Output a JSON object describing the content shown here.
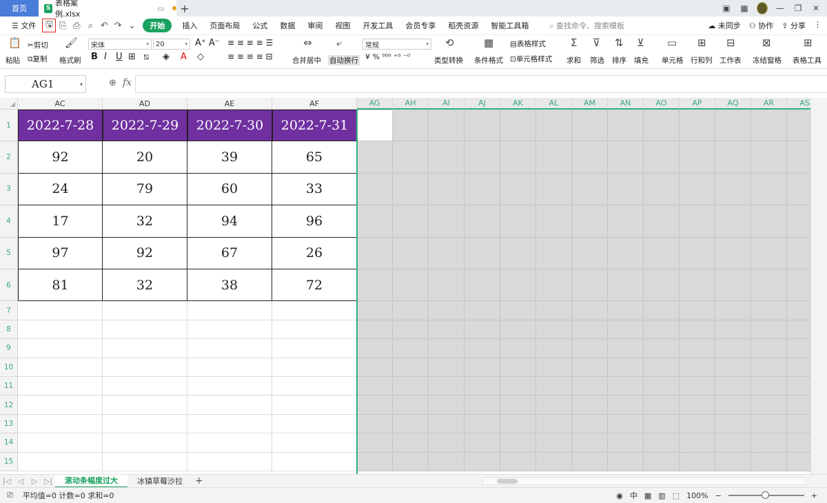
{
  "titlebar": {
    "home_tab": "首页",
    "file_tab": "表格案例.xlsx",
    "file_icon": "S"
  },
  "menubar": {
    "file": "文件",
    "active": "开始",
    "tabs": [
      "插入",
      "页面布局",
      "公式",
      "数据",
      "审阅",
      "视图",
      "开发工具",
      "会员专享",
      "稻壳资源",
      "智能工具箱"
    ],
    "search": "查找命令、搜索模板",
    "sync": "未同步",
    "collab": "协作",
    "share": "分享"
  },
  "ribbon": {
    "paste": "粘贴",
    "cut": "剪切",
    "copy": "复制",
    "format_painter": "格式刷",
    "font_name": "宋体",
    "font_size": "20",
    "merge_center": "合并居中",
    "wrap_text": "自动换行",
    "number_format": "常规",
    "type_convert": "类型转换",
    "conditional_format": "条件格式",
    "table_style": "表格样式",
    "cell_style": "单元格样式",
    "sum": "求和",
    "filter": "筛选",
    "sort": "排序",
    "fill": "填充",
    "cell": "单元格",
    "row_col": "行和列",
    "worksheet": "工作表",
    "freeze": "冻结窗格",
    "table_tools": "表格工具"
  },
  "formula": {
    "name_box": "AG1",
    "fx": "fx"
  },
  "grid": {
    "data_columns": [
      "AC",
      "AD",
      "AE",
      "AF"
    ],
    "gray_columns": [
      "AG",
      "AH",
      "AI",
      "AJ",
      "AK",
      "AL",
      "AM",
      "AN",
      "AO",
      "AP",
      "AQ",
      "AR",
      "AS"
    ],
    "row_numbers": [
      "1",
      "2",
      "3",
      "4",
      "5",
      "6",
      "7",
      "8",
      "9",
      "10",
      "11",
      "12",
      "13",
      "14",
      "15"
    ],
    "header_row": [
      "2022-7-28",
      "2022-7-29",
      "2022-7-30",
      "2022-7-31"
    ],
    "rows": [
      [
        "92",
        "20",
        "39",
        "65"
      ],
      [
        "24",
        "79",
        "60",
        "33"
      ],
      [
        "17",
        "32",
        "94",
        "96"
      ],
      [
        "97",
        "92",
        "67",
        "26"
      ],
      [
        "81",
        "32",
        "38",
        "72"
      ]
    ],
    "header_color": "#7030a0",
    "freeze_color": "#2bb27c"
  },
  "sheets": {
    "tabs": [
      "滚动条幅度过大",
      "冰镇草莓沙拉"
    ],
    "active": 0
  },
  "status": {
    "stats": "平均值=0  计数=0  求和=0",
    "zoom": "100%"
  }
}
